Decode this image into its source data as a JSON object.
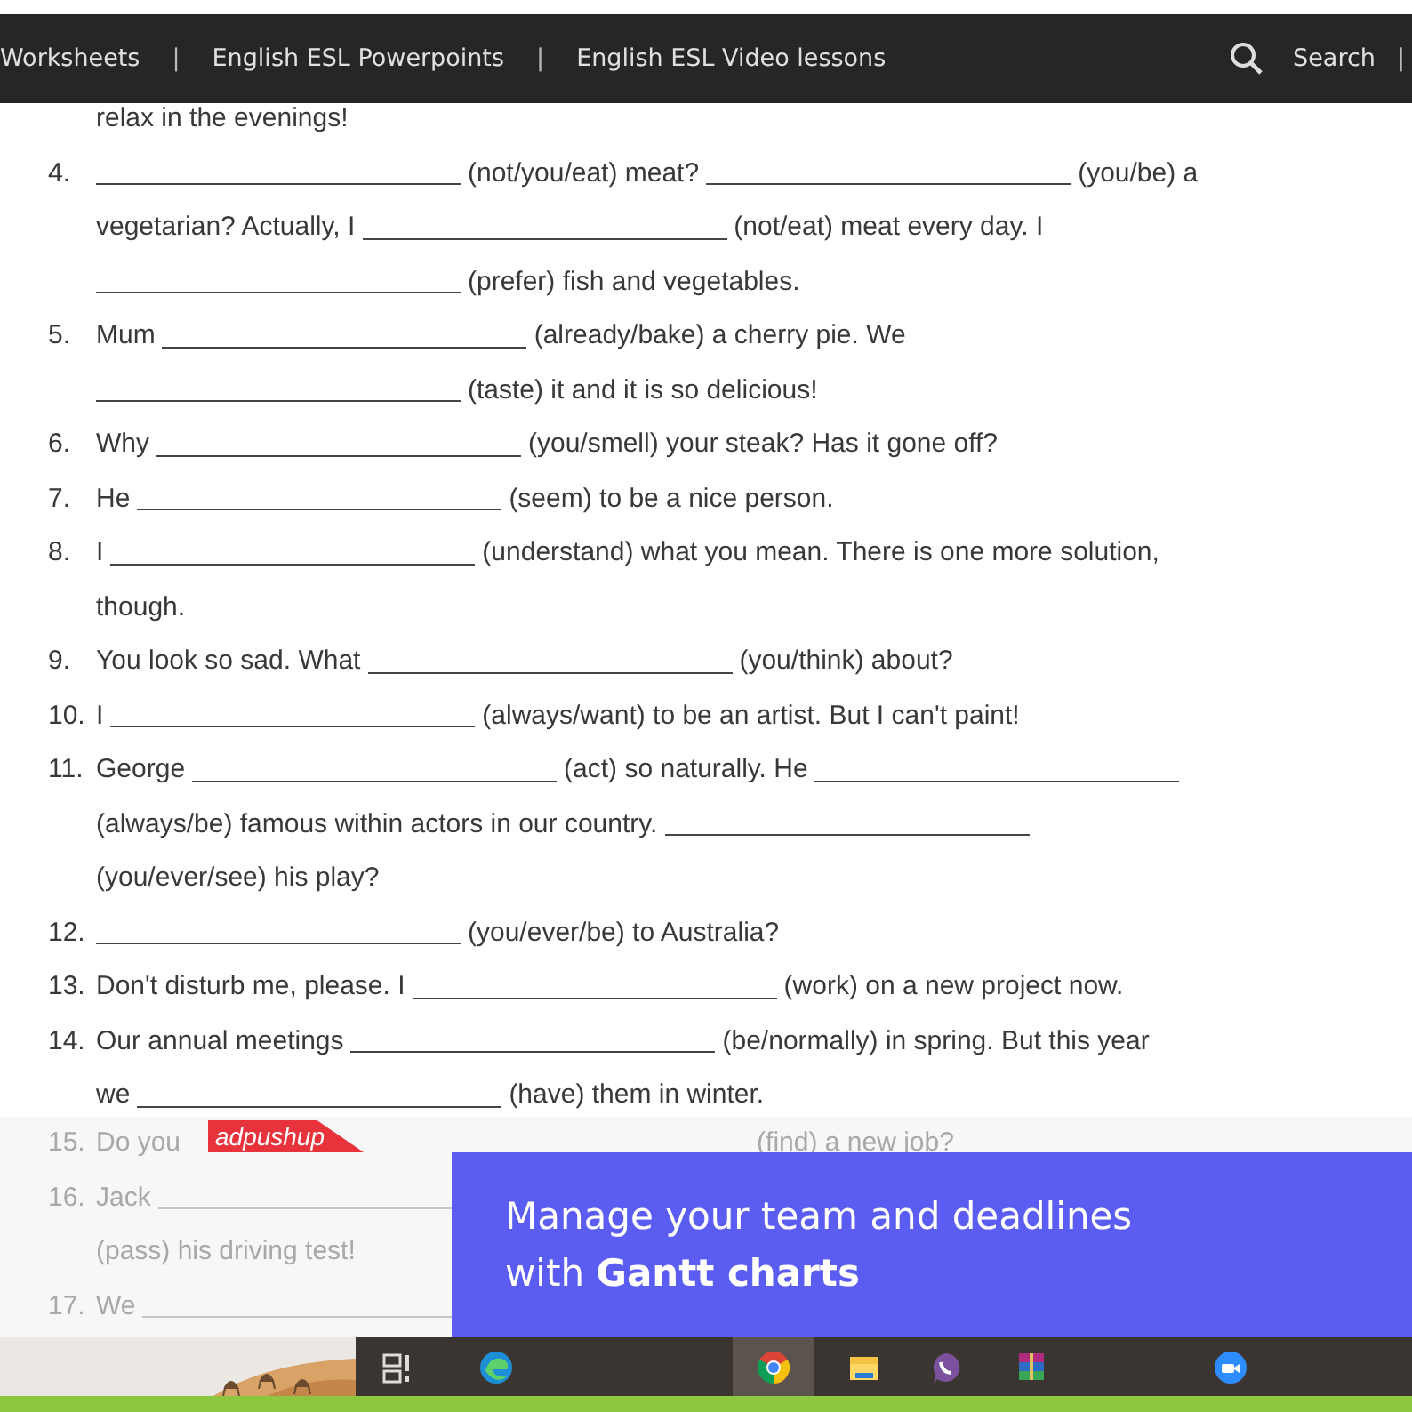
{
  "nav": {
    "links": [
      {
        "kind": "link",
        "text": "Worksheets"
      },
      {
        "kind": "separator",
        "text": "|"
      },
      {
        "kind": "link",
        "text": "English ESL Powerpoints"
      },
      {
        "kind": "separator",
        "text": "|"
      },
      {
        "kind": "link",
        "text": "English ESL Video lessons"
      }
    ],
    "search_label": "Search",
    "end_separator": "|"
  },
  "exercises": [
    {
      "lines": [
        [
          {
            "kind": "text",
            "text": "relax in the evenings!"
          }
        ]
      ]
    },
    {
      "number": "4.",
      "lines": [
        [
          {
            "kind": "blank"
          },
          {
            "kind": "text",
            "text": "(not/you/eat) meat?"
          },
          {
            "kind": "blank"
          },
          {
            "kind": "text",
            "text": "(you/be) a"
          }
        ],
        [
          {
            "kind": "text",
            "text": "vegetarian? Actually, I"
          },
          {
            "kind": "blank"
          },
          {
            "kind": "text",
            "text": "(not/eat) meat every day. I"
          }
        ],
        [
          {
            "kind": "blank"
          },
          {
            "kind": "text",
            "text": "(prefer) fish and vegetables."
          }
        ]
      ]
    },
    {
      "number": "5.",
      "lines": [
        [
          {
            "kind": "text",
            "text": "Mum"
          },
          {
            "kind": "blank"
          },
          {
            "kind": "text",
            "text": "(already/bake) a cherry pie. We"
          }
        ],
        [
          {
            "kind": "blank"
          },
          {
            "kind": "text",
            "text": "(taste) it and it is so delicious!"
          }
        ]
      ]
    },
    {
      "number": "6.",
      "lines": [
        [
          {
            "kind": "text",
            "text": "Why"
          },
          {
            "kind": "blank"
          },
          {
            "kind": "text",
            "text": "(you/smell) your steak? Has it gone off?"
          }
        ]
      ]
    },
    {
      "number": "7.",
      "lines": [
        [
          {
            "kind": "text",
            "text": "He"
          },
          {
            "kind": "blank"
          },
          {
            "kind": "text",
            "text": "(seem) to be a nice person."
          }
        ]
      ]
    },
    {
      "number": "8.",
      "lines": [
        [
          {
            "kind": "text",
            "text": "I"
          },
          {
            "kind": "blank"
          },
          {
            "kind": "text",
            "text": "(understand) what you mean. There is one more solution,"
          }
        ],
        [
          {
            "kind": "text",
            "text": "though."
          }
        ]
      ]
    },
    {
      "number": "9.",
      "lines": [
        [
          {
            "kind": "text",
            "text": "You look so sad. What"
          },
          {
            "kind": "blank"
          },
          {
            "kind": "text",
            "text": "(you/think) about?"
          }
        ]
      ]
    },
    {
      "number": "10.",
      "lines": [
        [
          {
            "kind": "text",
            "text": "I"
          },
          {
            "kind": "blank"
          },
          {
            "kind": "text",
            "text": "(always/want) to be an artist. But I can't paint!"
          }
        ]
      ]
    },
    {
      "number": "11.",
      "lines": [
        [
          {
            "kind": "text",
            "text": "George"
          },
          {
            "kind": "blank"
          },
          {
            "kind": "text",
            "text": "(act) so naturally. He"
          },
          {
            "kind": "blank"
          }
        ],
        [
          {
            "kind": "text",
            "text": "(always/be) famous within actors in our country."
          },
          {
            "kind": "blank"
          }
        ],
        [
          {
            "kind": "text",
            "text": "(you/ever/see) his play?"
          }
        ]
      ]
    },
    {
      "number": "12.",
      "lines": [
        [
          {
            "kind": "blank"
          },
          {
            "kind": "text",
            "text": "(you/ever/be) to Australia?"
          }
        ]
      ]
    },
    {
      "number": "13.",
      "lines": [
        [
          {
            "kind": "text",
            "text": "Don't disturb me, please. I"
          },
          {
            "kind": "blank"
          },
          {
            "kind": "text",
            "text": "(work) on a new project now."
          }
        ]
      ]
    },
    {
      "number": "14.",
      "lines": [
        [
          {
            "kind": "text",
            "text": "Our annual meetings"
          },
          {
            "kind": "blank"
          },
          {
            "kind": "text",
            "text": "(be/normally) in spring. But this year"
          }
        ],
        [
          {
            "kind": "text",
            "text": "we"
          },
          {
            "kind": "blank"
          },
          {
            "kind": "text",
            "text": "(have) them in winter."
          }
        ]
      ]
    }
  ],
  "covered_exercises": [
    {
      "number": "15.",
      "lines": [
        [
          {
            "kind": "text",
            "text": "Do you"
          },
          {
            "kind": "gap"
          },
          {
            "kind": "text",
            "text": "(find) a new job?"
          }
        ]
      ]
    },
    {
      "number": "16.",
      "lines": [
        [
          {
            "kind": "text",
            "text": "Jack"
          },
          {
            "kind": "blank"
          }
        ],
        [
          {
            "kind": "text",
            "text": "(pass) his driving test!"
          }
        ]
      ]
    },
    {
      "number": "17.",
      "lines": [
        [
          {
            "kind": "text",
            "text": "We"
          },
          {
            "kind": "blank"
          }
        ]
      ]
    }
  ],
  "ad_tag": "adpushup",
  "ad_banner": {
    "text": "Manage your team and deadlines with **Gantt charts**"
  },
  "taskbar": {
    "apps": [
      {
        "kind": "task-view",
        "selected": false
      },
      {
        "kind": "edge",
        "selected": false
      },
      {
        "kind": "chrome",
        "selected": true
      },
      {
        "kind": "folder",
        "selected": false
      },
      {
        "kind": "viber",
        "selected": false
      },
      {
        "kind": "archive",
        "selected": false
      },
      {
        "kind": "zoom",
        "selected": false
      }
    ]
  }
}
